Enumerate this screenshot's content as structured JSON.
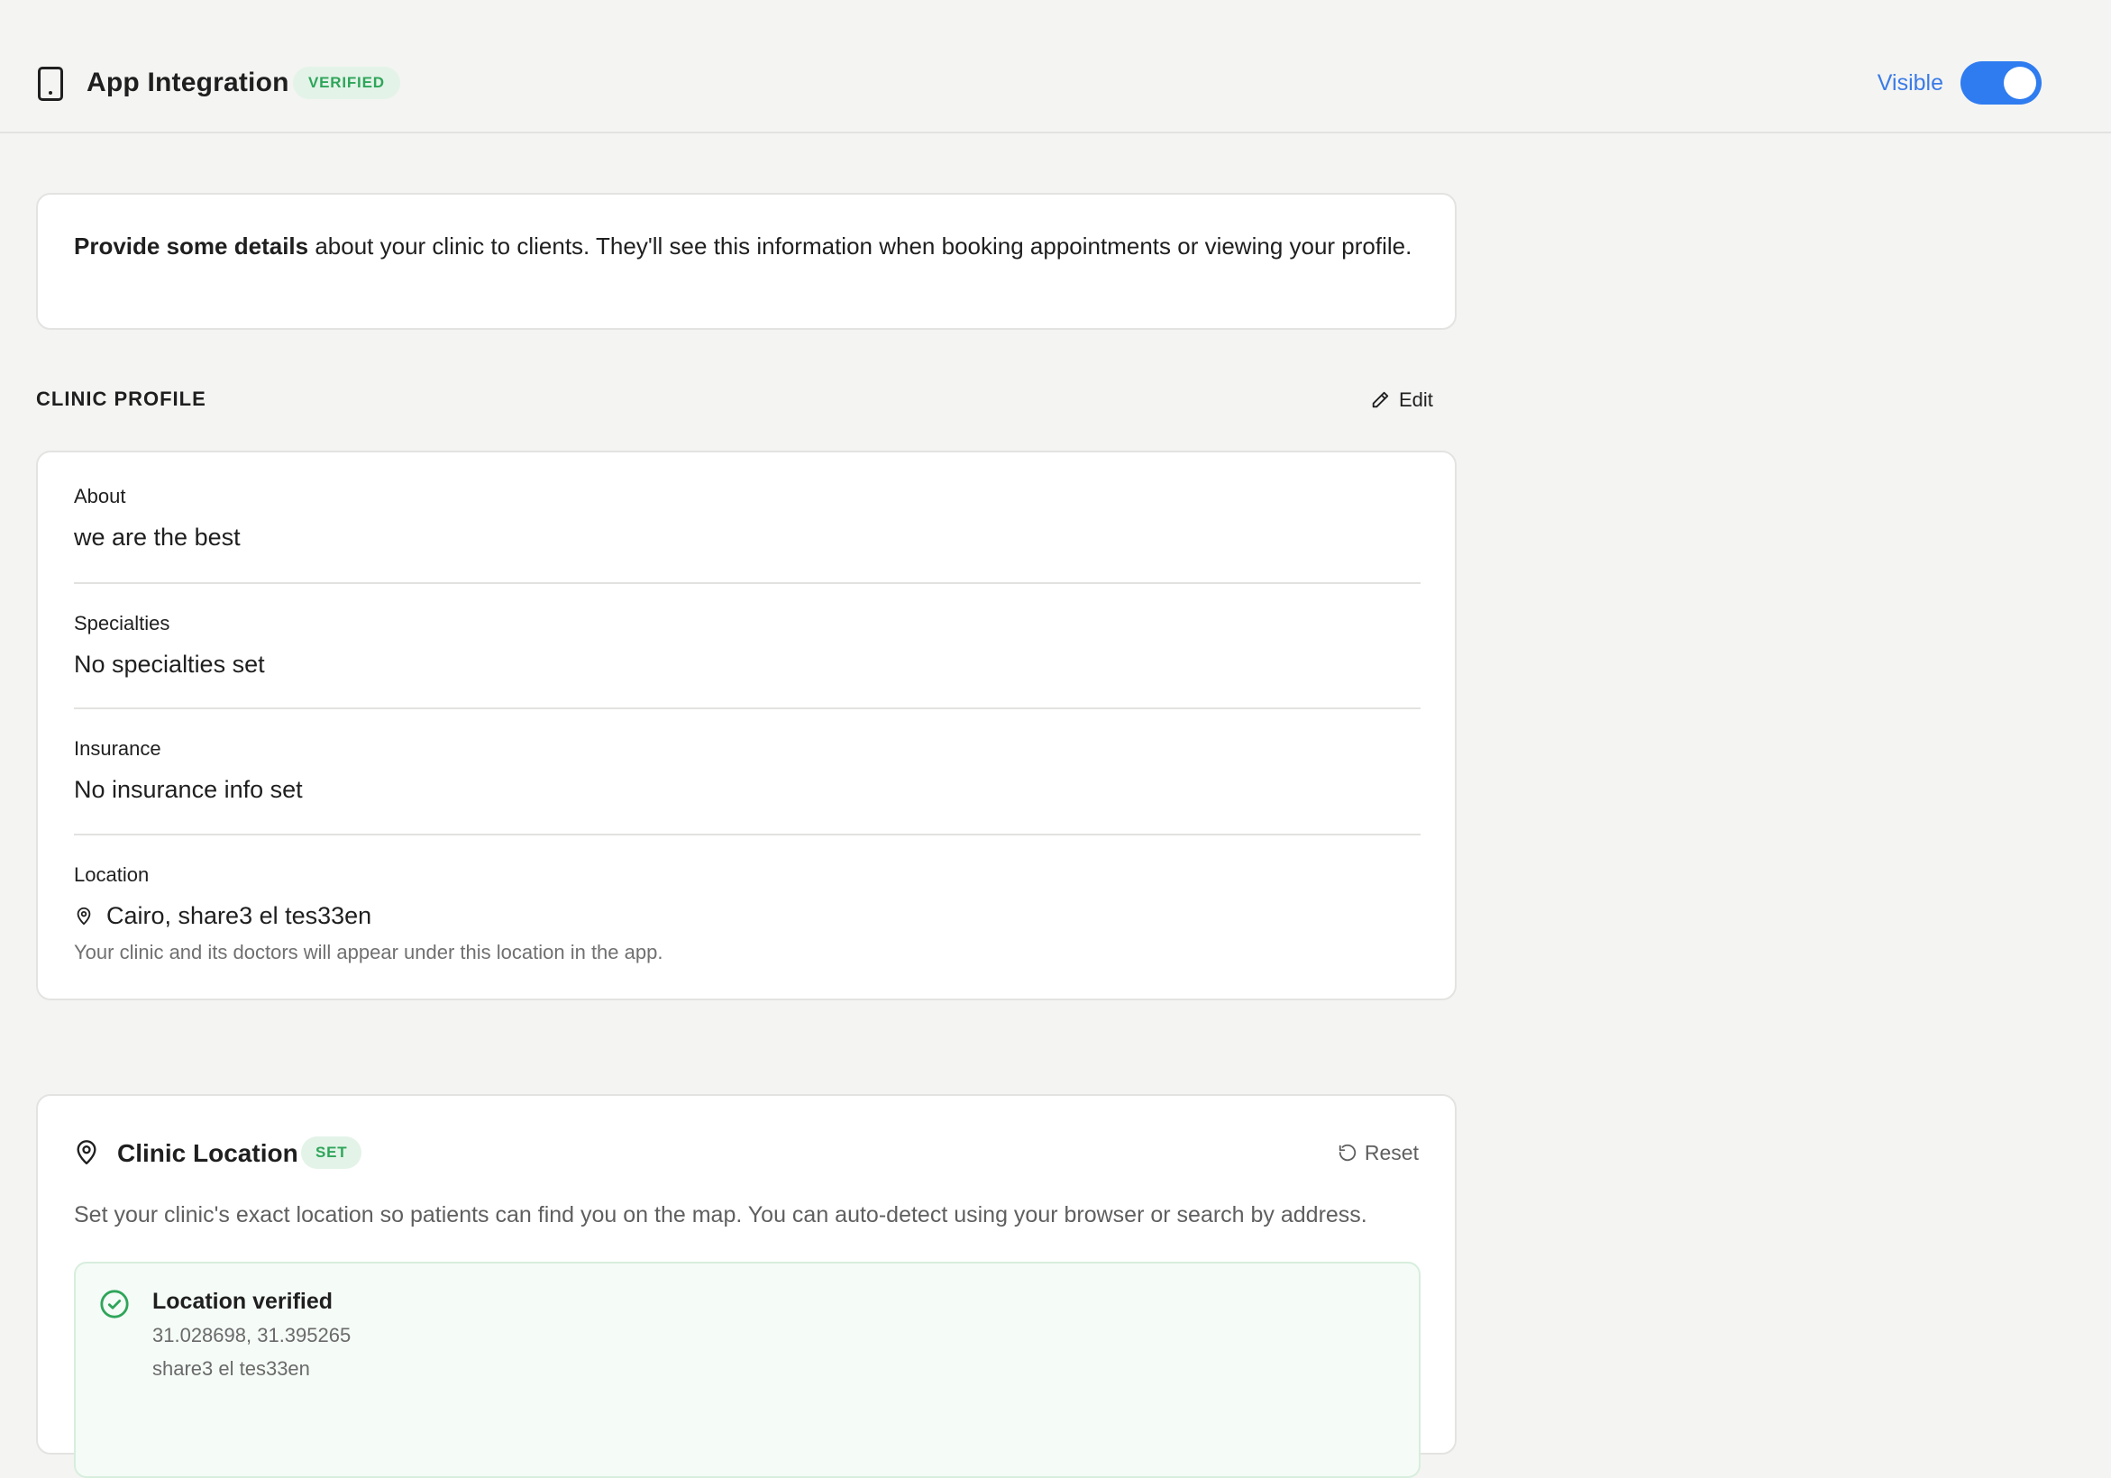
{
  "header": {
    "title": "App Integration",
    "status_badge": "VERIFIED",
    "visibility_label": "Visible",
    "visibility_on": true,
    "icon": "phone-icon"
  },
  "intro": {
    "strong": "Provide some details",
    "text": " about your clinic to clients. They'll see this information when booking appointments or viewing your profile."
  },
  "clinic_profile": {
    "heading": "CLINIC PROFILE",
    "edit_label": "Edit",
    "fields": [
      {
        "label": "About",
        "value": "we are the best"
      },
      {
        "label": "Specialties",
        "value": "No specialties set"
      },
      {
        "label": "Insurance",
        "value": "No insurance info set"
      },
      {
        "label": "Location",
        "value": "Cairo, share3 el tes33en",
        "helper": "Your clinic and its doctors will appear under this location in the app."
      }
    ]
  },
  "clinic_location": {
    "title": "Clinic Location",
    "badge": "SET",
    "reset_label": "Reset",
    "description": "Set your clinic's exact location so patients can find you on the map. You can auto-detect using your browser or search by address.",
    "verified": {
      "title": "Location verified",
      "coordinates": "31.028698, 31.395265",
      "address": "share3 el tes33en"
    }
  },
  "colors": {
    "accent": "#2f7cf0",
    "success": "#2fa55a",
    "background": "#f4f4f3"
  }
}
